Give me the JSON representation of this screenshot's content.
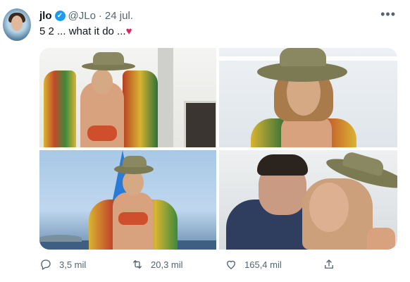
{
  "tweet": {
    "name": "jlo",
    "handle": "@JLo",
    "separator": "·",
    "date": "24 jul.",
    "text": "5  2 ... what it do ...",
    "text_emoji": "♥",
    "more_label": "•••"
  },
  "stats": {
    "replies": "3,5 mil",
    "retweets": "20,3 mil",
    "likes": "165,4 mil"
  },
  "colors": {
    "verified": "#1d9bf0",
    "heart": "#e0245e"
  }
}
